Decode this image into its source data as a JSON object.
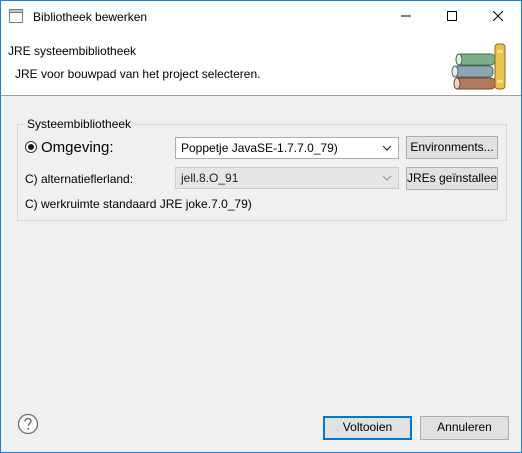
{
  "window": {
    "title": "Bibliotheek bewerken"
  },
  "banner": {
    "title": "JRE systeembibliotheek",
    "description": "JRE voor bouwpad van het project selecteren."
  },
  "group": {
    "label": "Systeembibliotheek",
    "environment_label": "Omgeving:",
    "environment_value": "Poppetje JavaSE-1.7.7.0_79)",
    "environments_button": "Environments...",
    "alternate_label": "C) alternatieflerland:",
    "alternate_value": "jell.8.O_91",
    "installed_jres_button": "JREs geïnstalleerd...",
    "workspace_default_label": "C) werkruimte standaard JRE joke.7.0_79)"
  },
  "footer": {
    "finish_button": "Voltooien",
    "cancel_button": "Annuleren"
  }
}
